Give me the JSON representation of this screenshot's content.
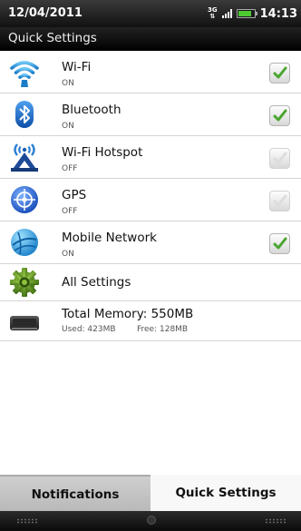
{
  "status": {
    "date": "12/04/2011",
    "network": "3G",
    "time": "14:13",
    "battery_level": 0.74
  },
  "panel": {
    "title": "Quick Settings"
  },
  "items": [
    {
      "title": "Wi-Fi",
      "state": "ON",
      "checked": true,
      "icon": "wifi-icon"
    },
    {
      "title": "Bluetooth",
      "state": "ON",
      "checked": true,
      "icon": "bluetooth-icon"
    },
    {
      "title": "Wi-Fi Hotspot",
      "state": "OFF",
      "checked": false,
      "icon": "wifi-hotspot-icon"
    },
    {
      "title": "GPS",
      "state": "OFF",
      "checked": false,
      "icon": "gps-icon"
    },
    {
      "title": "Mobile Network",
      "state": "ON",
      "checked": true,
      "icon": "mobile-network-icon"
    }
  ],
  "all_settings": {
    "label": "All Settings",
    "icon": "gear-icon"
  },
  "memory": {
    "title": "Total Memory: 550MB",
    "used": "Used: 423MB",
    "free": "Free: 128MB",
    "icon": "memory-icon"
  },
  "tabs": {
    "notifications": "Notifications",
    "quick_settings": "Quick Settings",
    "active": "quick_settings"
  },
  "colors": {
    "check_green": "#4aa52e",
    "status_bar": "#1a1a1a",
    "tab_inactive": "#c4c4c4",
    "battery_green": "#4dca2f"
  }
}
